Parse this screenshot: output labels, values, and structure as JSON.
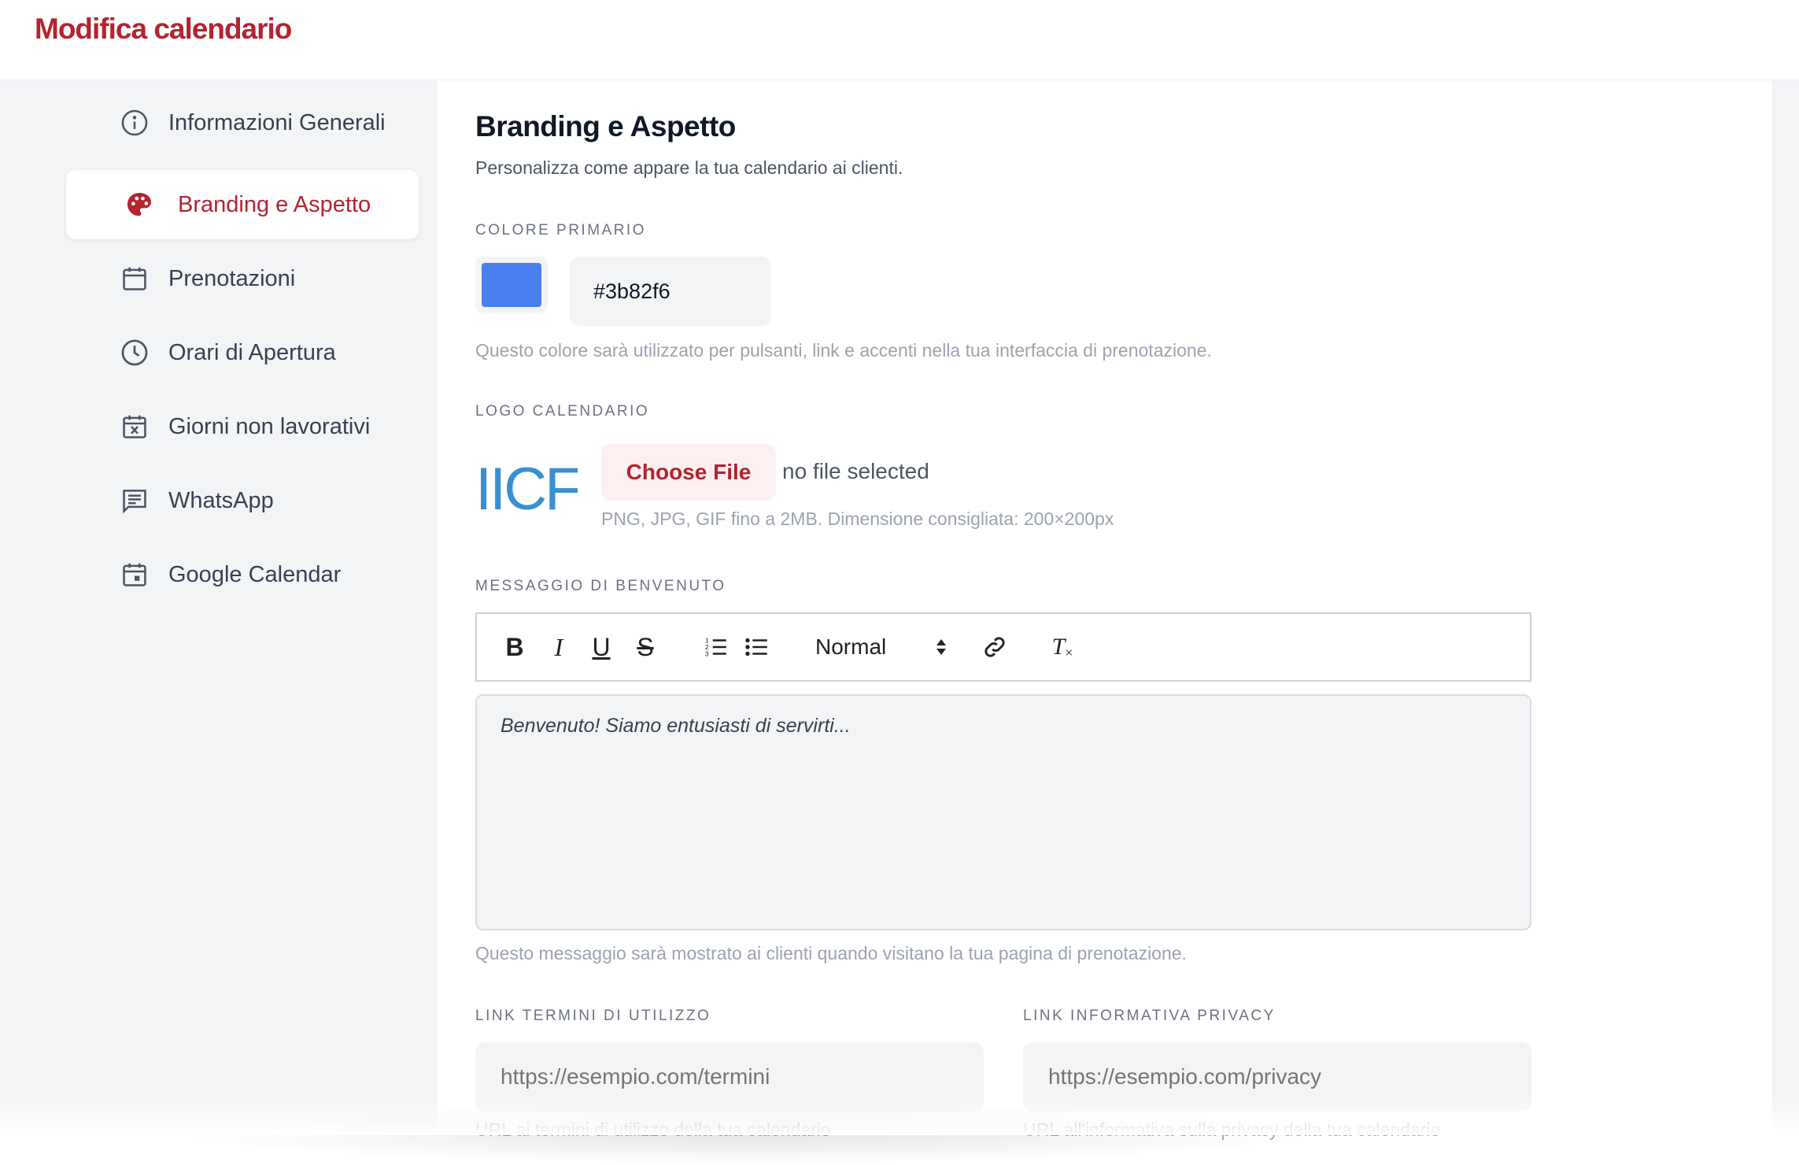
{
  "header": {
    "title": "Modifica calendario"
  },
  "colors": {
    "brand": "#b4232f",
    "primary_swatch": "#4b7ff0",
    "logo_blue": "#3a8fd0"
  },
  "sidebar": {
    "items": [
      {
        "label": "Informazioni Generali",
        "icon": "info-icon",
        "active": false
      },
      {
        "label": "Branding e Aspetto",
        "icon": "palette-icon",
        "active": true
      },
      {
        "label": "Prenotazioni",
        "icon": "calendar-icon",
        "active": false
      },
      {
        "label": "Orari di Apertura",
        "icon": "clock-icon",
        "active": false
      },
      {
        "label": "Giorni non lavorativi",
        "icon": "calendar-x-icon",
        "active": false
      },
      {
        "label": "WhatsApp",
        "icon": "message-icon",
        "active": false
      },
      {
        "label": "Google Calendar",
        "icon": "calendar-event-icon",
        "active": false
      }
    ]
  },
  "main": {
    "title": "Branding e Aspetto",
    "subtitle": "Personalizza come appare la tua calendario ai clienti.",
    "primary_color": {
      "label": "COLORE PRIMARIO",
      "value": "#3b82f6",
      "help": "Questo colore sarà utilizzato per pulsanti, link e accenti nella tua interfaccia di prenotazione."
    },
    "logo": {
      "label": "LOGO CALENDARIO",
      "preview_text": "IICF",
      "choose_label": "Choose File",
      "status": "no file selected",
      "help": "PNG, JPG, GIF fino a 2MB. Dimensione consigliata: 200×200px"
    },
    "welcome": {
      "label": "MESSAGGIO DI BENVENUTO",
      "toolbar": {
        "bold": "B",
        "italic": "I",
        "underline": "U",
        "strike": "S",
        "format": "Normal",
        "clear": "T"
      },
      "placeholder": "Benvenuto! Siamo entusiasti di servirti...",
      "help": "Questo messaggio sarà mostrato ai clienti quando visitano la tua pagina di prenotazione."
    },
    "terms": {
      "label": "LINK TERMINI DI UTILIZZO",
      "placeholder": "https://esempio.com/termini",
      "help": "URL ai termini di utilizzo della tua calendario"
    },
    "privacy": {
      "label": "LINK INFORMATIVA PRIVACY",
      "placeholder": "https://esempio.com/privacy",
      "help": "URL all'informativa sulla privacy della tua calendario"
    }
  }
}
